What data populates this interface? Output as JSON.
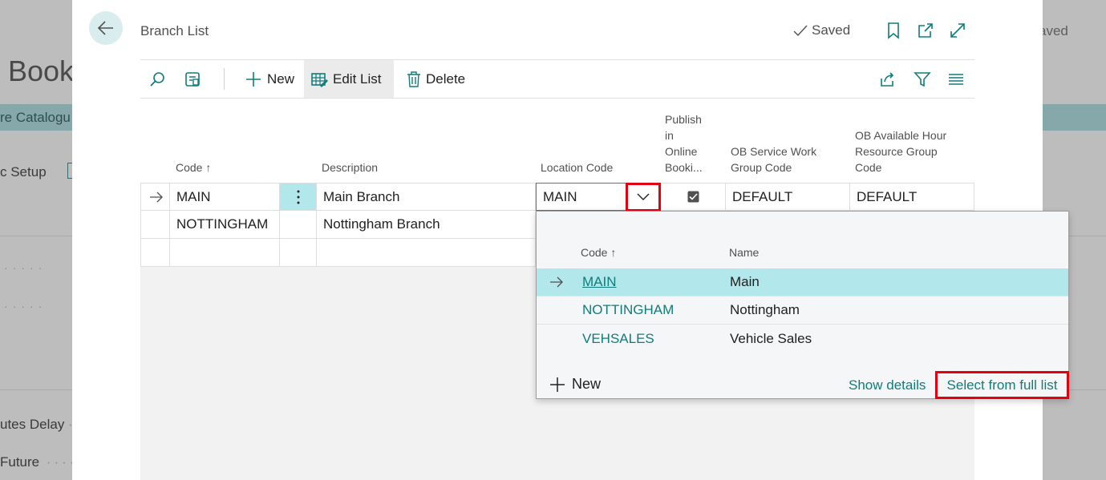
{
  "background": {
    "page_title": "Book",
    "band_text": "re Catalogu",
    "setup_text": "c Setup",
    "delay_text": "utes Delay",
    "future_text": "Future",
    "saved_text": "aved"
  },
  "header": {
    "caption": "Branch List",
    "saved_label": "Saved"
  },
  "actions": {
    "new_label": "New",
    "edit_list_label": "Edit List",
    "delete_label": "Delete"
  },
  "columns": {
    "code": "Code",
    "description": "Description",
    "location_code": "Location Code",
    "publish_l1": "Publish",
    "publish_l2": "in",
    "publish_l3": "Online",
    "publish_l4": "Booki...",
    "ob_service_l1": "OB Service Work",
    "ob_service_l2": "Group Code",
    "ob_avail_l1": "OB Available Hour",
    "ob_avail_l2": "Resource Group",
    "ob_avail_l3": "Code"
  },
  "rows": [
    {
      "code": "MAIN",
      "description": "Main Branch",
      "location_code": "MAIN",
      "publish": true,
      "ob_service": "DEFAULT",
      "ob_available": "DEFAULT"
    },
    {
      "code": "NOTTINGHAM",
      "description": "Nottingham Branch"
    }
  ],
  "dropdown": {
    "code_header": "Code",
    "name_header": "Name",
    "items": [
      {
        "code": "MAIN",
        "name": "Main"
      },
      {
        "code": "NOTTINGHAM",
        "name": "Nottingham"
      },
      {
        "code": "VEHSALES",
        "name": "Vehicle Sales"
      }
    ],
    "new_label": "New",
    "show_details_label": "Show details",
    "select_full_label": "Select from full list"
  },
  "colors": {
    "accent": "#107c7c",
    "selected_row": "#b2e7eb",
    "highlight_box": "#e3000f"
  }
}
